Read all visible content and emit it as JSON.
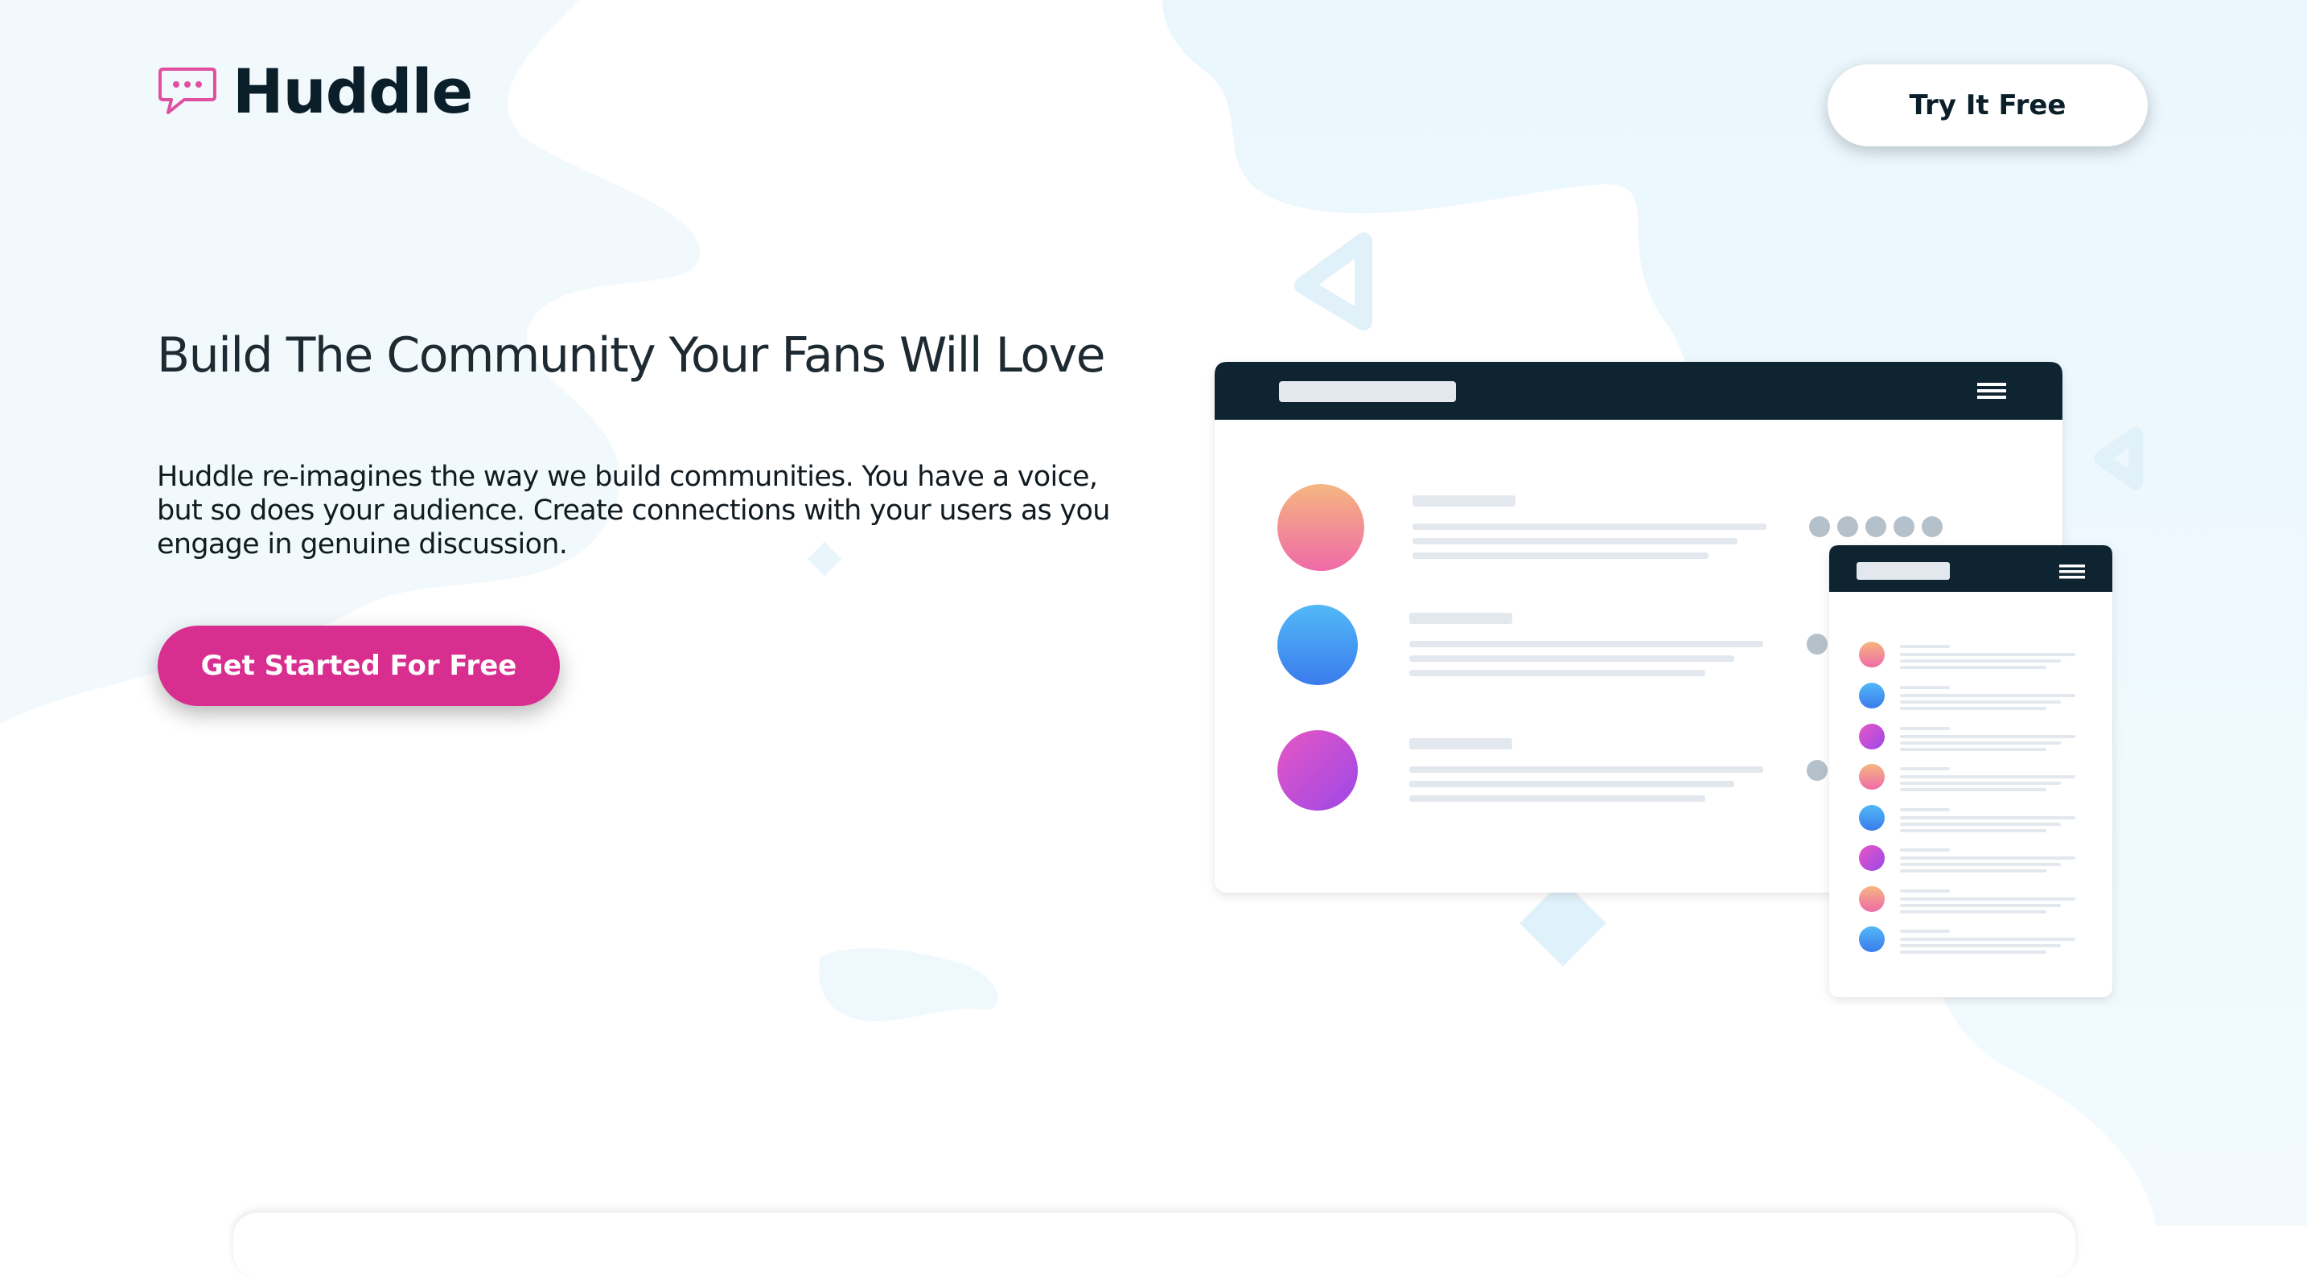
{
  "header": {
    "logo_text": "Huddle",
    "logo_icon": "chat-bubble-icon",
    "try_button_label": "Try It Free"
  },
  "hero": {
    "title": "Build The Community Your Fans Will Love",
    "description": "Huddle re-imagines the way we build communities. You have a voice, but so does your audience. Create connections with your users as you engage in genuine discussion.",
    "cta_label": "Get Started For Free"
  },
  "colors": {
    "brand_pink": "#d82e8f",
    "dark_navy": "#0b1f2b",
    "background_blob": "#e8f6fd",
    "mockup_header": "#0e2430"
  },
  "mockup": {
    "desktop_rows": [
      "avatar-orange-pink",
      "avatar-blue",
      "avatar-magenta-purple"
    ],
    "mobile_rows": [
      "avatar-orange-pink",
      "avatar-blue",
      "avatar-magenta",
      "avatar-orange-pink",
      "avatar-blue",
      "avatar-magenta",
      "avatar-orange-pink",
      "avatar-blue"
    ]
  }
}
